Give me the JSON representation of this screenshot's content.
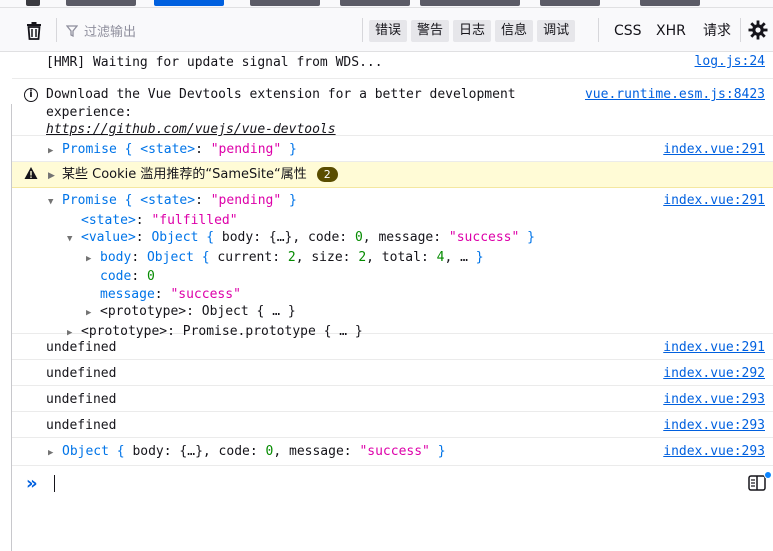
{
  "toolbar": {
    "filter_placeholder": "过滤输出",
    "levels": [
      "错误",
      "警告",
      "日志",
      "信息",
      "调试"
    ],
    "requests": [
      "CSS",
      "XHR",
      "请求"
    ]
  },
  "log": [
    {
      "kind": "plain",
      "text": "[HMR] Waiting for update signal from WDS...",
      "source": "log.js:24"
    },
    {
      "kind": "info",
      "text": "Download the Vue Devtools extension for a better development experience:",
      "link": "https://github.com/vuejs/vue-devtools",
      "source": "vue.runtime.esm.js:8423"
    },
    {
      "kind": "promise-collapsed",
      "label": "Promise",
      "key": "<state>",
      "value": "\"pending\"",
      "source": "index.vue:291"
    },
    {
      "kind": "warning",
      "text": "某些 Cookie 滥用推荐的“SameSite“属性",
      "count": "2"
    },
    {
      "kind": "promise-expanded",
      "source": "index.vue:291",
      "head": {
        "label": "Promise",
        "key": "<state>",
        "value": "\"pending\""
      },
      "state": {
        "key": "<state>",
        "value": "\"fulfilled\""
      },
      "value": {
        "key": "<value>",
        "summary_type": "Object",
        "summary": "body: {…}, code: 0, message: \"success\""
      },
      "body": {
        "key": "body",
        "summary_type": "Object",
        "current": "2",
        "size": "2",
        "total": "4"
      },
      "code": {
        "key": "code",
        "value": "0"
      },
      "message": {
        "key": "message",
        "value": "\"success\""
      },
      "inner_proto": {
        "key": "<prototype>",
        "value": "Object { … }"
      },
      "outer_proto": {
        "key": "<prototype>",
        "value": "Promise.prototype { … }"
      }
    },
    {
      "kind": "plain",
      "text": "undefined",
      "source": "index.vue:291"
    },
    {
      "kind": "plain",
      "text": "undefined",
      "source": "index.vue:292"
    },
    {
      "kind": "plain",
      "text": "undefined",
      "source": "index.vue:293"
    },
    {
      "kind": "plain",
      "text": "undefined",
      "source": "index.vue:293"
    },
    {
      "kind": "object-collapsed",
      "label": "Object",
      "code": "0",
      "message": "\"success\"",
      "source": "index.vue:293"
    }
  ],
  "colors": {
    "link": "#0060df",
    "keyword": "#0074e8",
    "string": "#dd00a9",
    "number": "#058b00",
    "warning_bg": "#fffbd6",
    "badge": "#5a4d00"
  },
  "icons": [
    "trash-icon",
    "filter-icon",
    "gear-icon",
    "info-icon",
    "warning-icon",
    "chevron-prompt-icon",
    "editor-mode-icon"
  ]
}
